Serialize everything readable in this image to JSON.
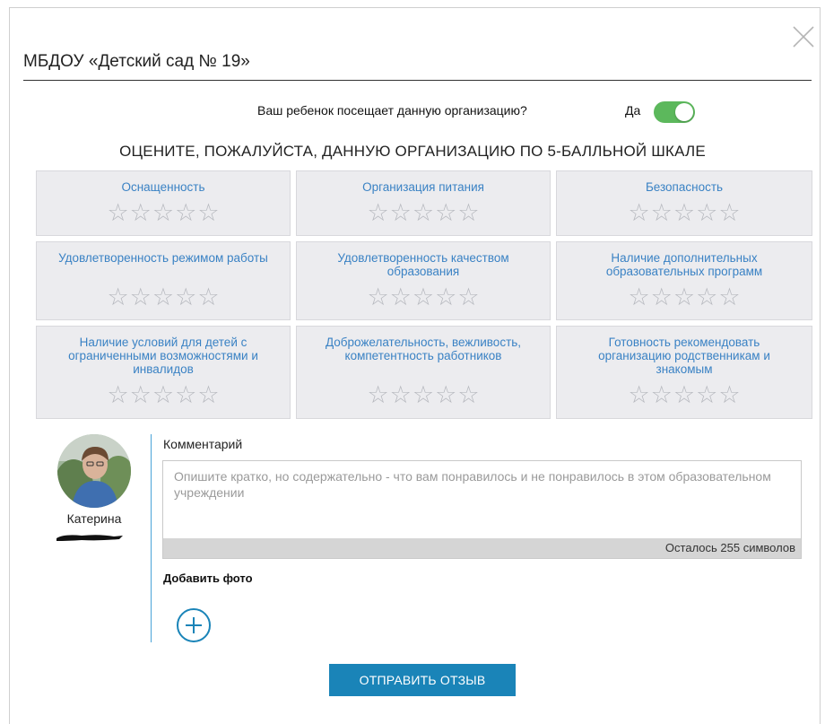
{
  "modal": {
    "title": "МБДОУ «Детский сад № 19»",
    "close_icon": "close-icon"
  },
  "attendance": {
    "question": "Ваш ребенок посещает данную организацию?",
    "answer": "Да",
    "toggle_on": true,
    "toggle_color": "#5cb85c"
  },
  "rating": {
    "heading": "ОЦЕНИТЕ, ПОЖАЛУЙСТА, ДАННУЮ ОРГАНИЗАЦИЮ ПО 5-БАЛЛЬНОЙ ШКАЛЕ",
    "max_stars": 5,
    "criteria": [
      {
        "label": "Оснащенность",
        "value": 0
      },
      {
        "label": "Организация питания",
        "value": 0
      },
      {
        "label": "Безопасность",
        "value": 0
      },
      {
        "label": "Удовлетворенность режимом работы",
        "value": 0
      },
      {
        "label": "Удовлетворенность качеством образования",
        "value": 0
      },
      {
        "label": "Наличие дополнительных образовательных программ",
        "value": 0
      },
      {
        "label": "Наличие условий для детей с ограниченными возможностями и инвалидов",
        "value": 0
      },
      {
        "label": "Доброжелательность, вежливость, компетентность работников",
        "value": 0
      },
      {
        "label": "Готовность рекомендовать организацию родственникам и знакомым",
        "value": 0
      }
    ],
    "label_color": "#3a82c4",
    "star_color": "#b7b9bf"
  },
  "user": {
    "name": "Катерина",
    "avatar_icon": "avatar"
  },
  "comment": {
    "label": "Комментарий",
    "value": "",
    "placeholder": "Опишите кратко, но содержательно - что вам понравилось и не понравилось в этом образовательном учреждении",
    "counter": "Осталось 255 символов"
  },
  "photo": {
    "label": "Добавить фото",
    "add_icon": "plus-circle-icon"
  },
  "submit": {
    "label": "ОТПРАВИТЬ ОТЗЫВ",
    "color": "#1a84b8"
  }
}
